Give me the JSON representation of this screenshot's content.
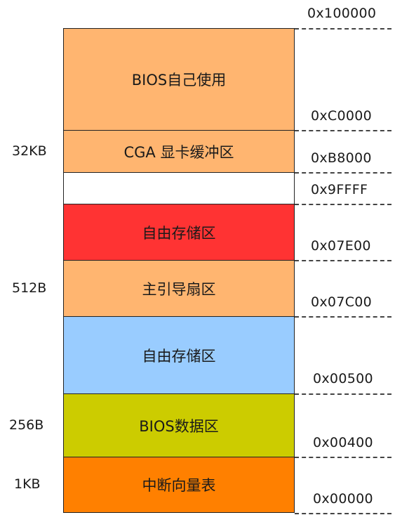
{
  "blocks": [
    {
      "id": "bios-own-use",
      "label": "BIOS自己使用",
      "color": "#FFB570"
    },
    {
      "id": "cga-buffer",
      "label": "CGA 显卡缓冲区",
      "color": "#FFB570"
    },
    {
      "id": "reserved-empty",
      "label": "",
      "color": "#FFFFFF"
    },
    {
      "id": "free-storage-upper",
      "label": "自由存储区",
      "color": "#FF3333"
    },
    {
      "id": "master-boot-sector",
      "label": "主引导扇区",
      "color": "#FFB570"
    },
    {
      "id": "free-storage-lower",
      "label": "自由存储区",
      "color": "#99CCFF"
    },
    {
      "id": "bios-data-area",
      "label": "BIOS数据区",
      "color": "#CCCC00"
    },
    {
      "id": "interrupt-vector-table",
      "label": "中断向量表",
      "color": "#FF8000"
    }
  ],
  "addresses": [
    "0x100000",
    "0xC0000",
    "0xB8000",
    "0x9FFFF",
    "0x07E00",
    "0x07C00",
    "0x00500",
    "0x00400",
    "0x00000"
  ],
  "sizes": [
    "32KB",
    "512B",
    "256B",
    "1KB"
  ]
}
